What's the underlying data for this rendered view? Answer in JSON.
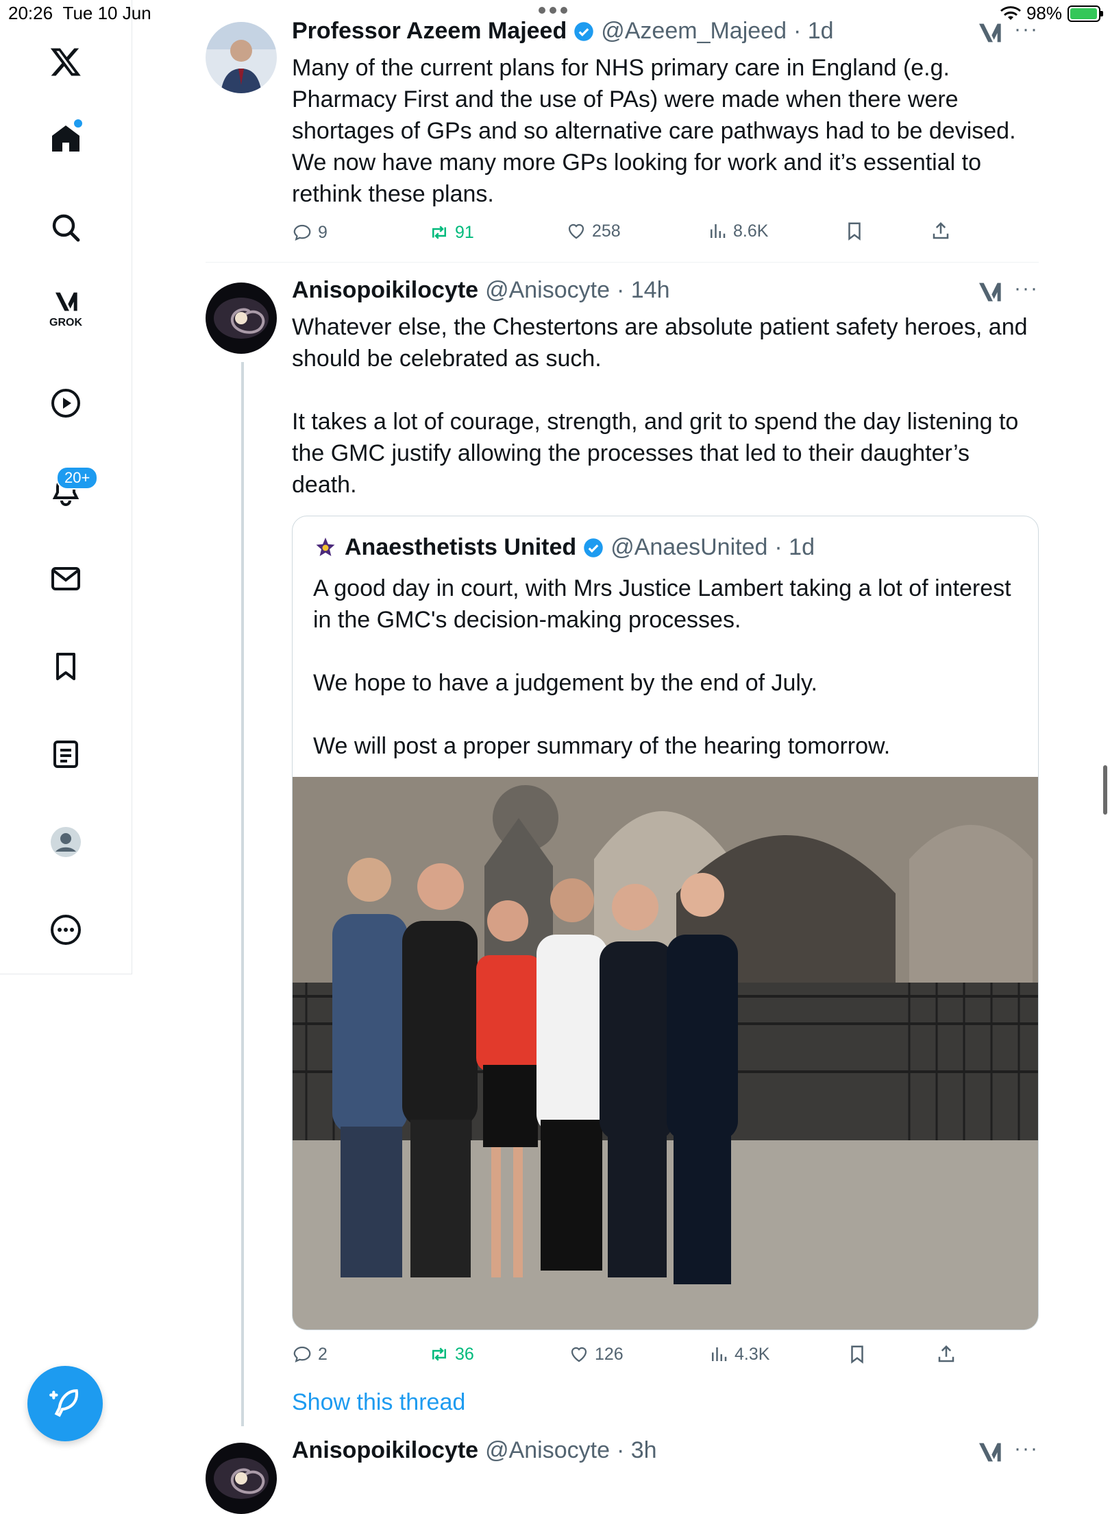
{
  "status": {
    "time": "20:26",
    "date": "Tue 10 Jun",
    "battery": "98%",
    "battery_level": 0.98
  },
  "sidebar": {
    "items": [
      {
        "name": "x-logo-icon"
      },
      {
        "name": "home-icon"
      },
      {
        "name": "search-icon"
      },
      {
        "name": "grok-icon",
        "label": "GROK"
      },
      {
        "name": "video-icon"
      },
      {
        "name": "notifications-icon",
        "badge": "20+"
      },
      {
        "name": "messages-icon"
      },
      {
        "name": "bookmarks-icon"
      },
      {
        "name": "lists-icon"
      },
      {
        "name": "profile-icon"
      },
      {
        "name": "more-icon"
      }
    ],
    "compose": "compose-icon"
  },
  "tweets": [
    {
      "name": "Professor Azeem Majeed",
      "handle": "@Azeem_Majeed",
      "time": "· 1d",
      "text": "Many of the current plans for NHS primary care in England (e.g. Pharmacy First and the use of PAs) were made when there were shortages of GPs and so alternative care pathways had to be devised. We now have many more GPs looking for work and it’s essential to rethink these plans.",
      "replies": "9",
      "retweets": "91",
      "likes": "258",
      "views": "8.6K"
    },
    {
      "name": "Anisopoikilocyte",
      "handle": "@Anisocyte",
      "time": "· 14h",
      "text": "Whatever else, the Chestertons are absolute patient safety heroes, and should be celebrated as such.\n\nIt takes a lot of courage, strength, and grit to spend the day listening to the GMC justify allowing the processes that led to their daughter’s death.",
      "quote": {
        "name": "Anaesthetists United",
        "handle": "@AnaesUnited",
        "time": "· 1d",
        "text": "A good day in court, with Mrs Justice Lambert taking a lot of interest in the GMC's decision-making processes.\n\nWe hope to have a judgement by the end of July.\n\nWe will post a proper summary of the hearing tomorrow."
      },
      "replies": "2",
      "retweets": "36",
      "likes": "126",
      "views": "4.3K",
      "show_thread": "Show this thread"
    },
    {
      "name": "Anisopoikilocyte",
      "handle": "@Anisocyte",
      "time": "· 3h"
    }
  ],
  "colors": {
    "accent": "#1d9bf0",
    "retweet": "#00ba7c",
    "muted": "#536471"
  }
}
